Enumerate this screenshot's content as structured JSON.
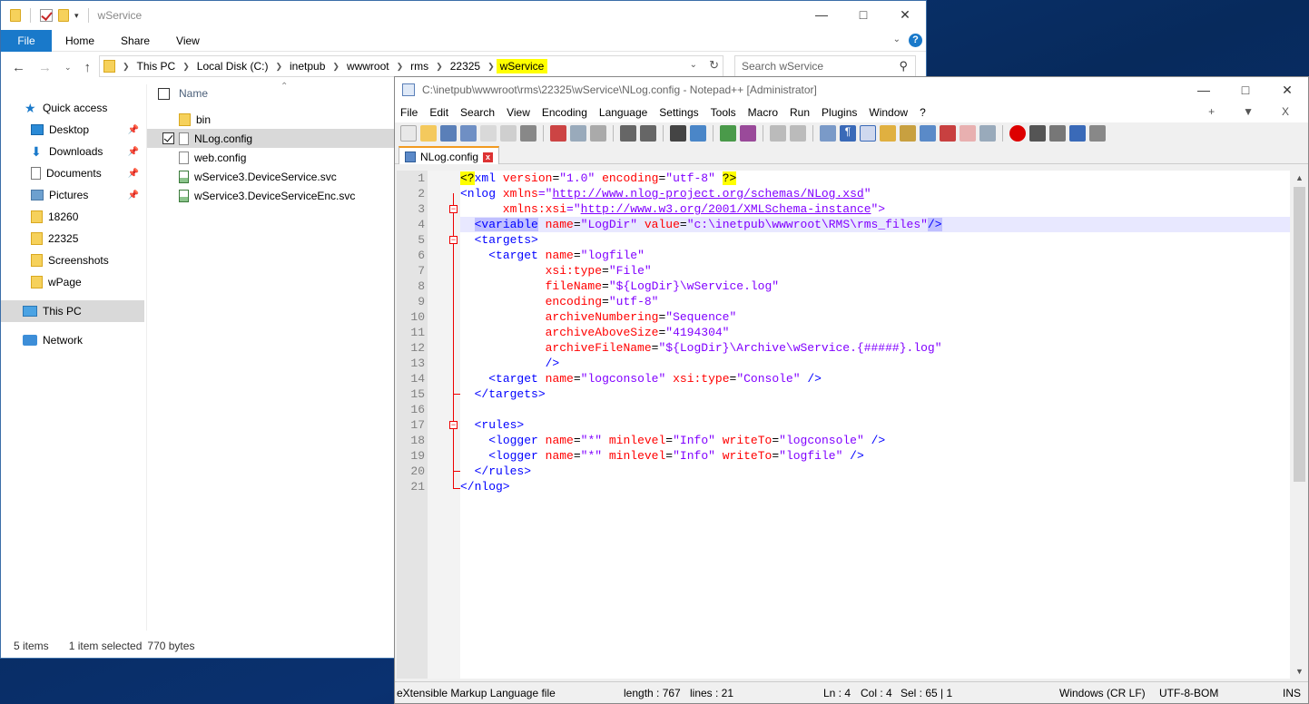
{
  "explorer": {
    "title": "wService",
    "ribbon_tabs": {
      "file": "File",
      "home": "Home",
      "share": "Share",
      "view": "View"
    },
    "crumbs": [
      "This PC",
      "Local Disk (C:)",
      "inetpub",
      "wwwroot",
      "rms",
      "22325",
      "wService"
    ],
    "search_placeholder": "Search wService",
    "nav": {
      "quick_access": "Quick access",
      "desktop": "Desktop",
      "downloads": "Downloads",
      "documents": "Documents",
      "pictures": "Pictures",
      "f1": "18260",
      "f2": "22325",
      "f3": "Screenshots",
      "f4": "wPage",
      "this_pc": "This PC",
      "network": "Network"
    },
    "column_name": "Name",
    "files": [
      "bin",
      "NLog.config",
      "web.config",
      "wService3.DeviceService.svc",
      "wService3.DeviceServiceEnc.svc"
    ],
    "status": {
      "items": "5 items",
      "selected": "1 item selected",
      "size": "770 bytes"
    }
  },
  "npp": {
    "title": "C:\\inetpub\\wwwroot\\rms\\22325\\wService\\NLog.config - Notepad++ [Administrator]",
    "menu": [
      "File",
      "Edit",
      "Search",
      "View",
      "Encoding",
      "Language",
      "Settings",
      "Tools",
      "Macro",
      "Run",
      "Plugins",
      "Window",
      "?"
    ],
    "menu_right": {
      "plus": "+",
      "down": "▼",
      "close": "X"
    },
    "tab_label": "NLog.config",
    "lines": [
      "1",
      "2",
      "3",
      "4",
      "5",
      "6",
      "7",
      "8",
      "9",
      "10",
      "11",
      "12",
      "13",
      "14",
      "15",
      "16",
      "17",
      "18",
      "19",
      "20",
      "21"
    ],
    "code": {
      "l1a": "<?",
      "l1b": "xml ",
      "l1c": "version",
      "l1d": "=",
      "l1e": "\"1.0\"",
      "l1f": " encoding",
      "l1g": "=",
      "l1h": "\"utf-8\"",
      "l1i": " ",
      "l1j": "?>",
      "l2a": "<nlog ",
      "l2b": "xmlns",
      "l2c": "=\"",
      "l2d": "http://www.nlog-project.org/schemas/NLog.xsd",
      "l2e": "\"",
      "l3a": "      xmlns:xsi",
      "l3b": "=\"",
      "l3c": "http://www.w3.org/2001/XMLSchema-instance",
      "l3d": "\">",
      "l4a": "<variable",
      "l4b": " name",
      "l4c": "=",
      "l4d": "\"LogDir\"",
      "l4e": " value",
      "l4f": "=",
      "l4g": "\"c:\\inetpub\\wwwroot\\RMS\\rms_files\"",
      "l4h": "/>",
      "l5": "<targets>",
      "l6a": "<target ",
      "l6b": "name",
      "l6c": "=",
      "l6d": "\"logfile\"",
      "l7a": "xsi:type",
      "l7b": "=",
      "l7c": "\"File\"",
      "l8a": "fileName",
      "l8b": "=",
      "l8c": "\"${LogDir}\\wService.log\"",
      "l9a": "encoding",
      "l9b": "=",
      "l9c": "\"utf-8\"",
      "l10a": "archiveNumbering",
      "l10b": "=",
      "l10c": "\"Sequence\"",
      "l11a": "archiveAboveSize",
      "l11b": "=",
      "l11c": "\"4194304\"",
      "l12a": "archiveFileName",
      "l12b": "=",
      "l12c": "\"${LogDir}\\Archive\\wService.{#####}.log\"",
      "l13": "/>",
      "l14a": "<target ",
      "l14b": "name",
      "l14c": "=",
      "l14d": "\"logconsole\"",
      "l14e": " xsi:type",
      "l14f": "=",
      "l14g": "\"Console\"",
      "l14h": " />",
      "l15": "</targets>",
      "l17": "<rules>",
      "l18a": "<logger ",
      "l18b": "name",
      "l18c": "=",
      "l18d": "\"*\"",
      "l18e": " minlevel",
      "l18f": "=",
      "l18g": "\"Info\"",
      "l18h": " writeTo",
      "l18i": "=",
      "l18j": "\"logconsole\"",
      "l18k": " />",
      "l19a": "<logger ",
      "l19b": "name",
      "l19c": "=",
      "l19d": "\"*\"",
      "l19e": " minlevel",
      "l19f": "=",
      "l19g": "\"Info\"",
      "l19h": " writeTo",
      "l19i": "=",
      "l19j": "\"logfile\"",
      "l19k": " />",
      "l20": "</rules>",
      "l21": "</nlog>"
    },
    "status": {
      "type": "eXtensible Markup Language file",
      "length": "length : 767",
      "lines": "lines : 21",
      "ln": "Ln : 4",
      "col": "Col : 4",
      "sel": "Sel : 65 | 1",
      "eol": "Windows (CR LF)",
      "enc": "UTF-8-BOM",
      "ins": "INS"
    }
  }
}
